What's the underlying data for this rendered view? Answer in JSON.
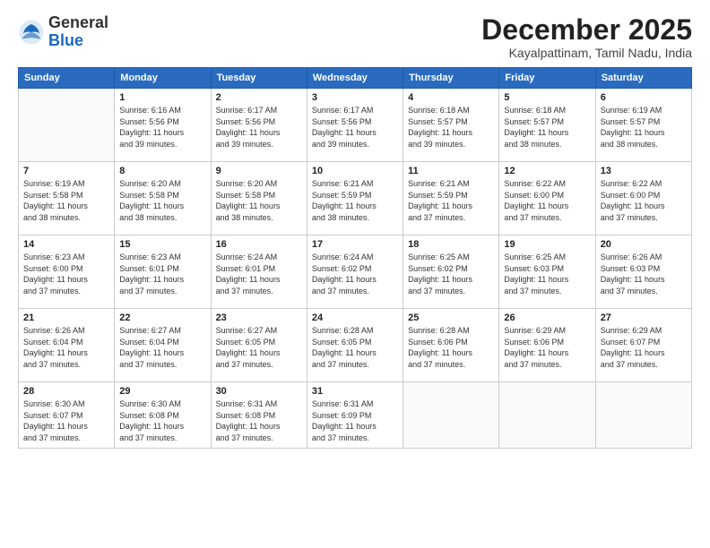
{
  "logo": {
    "general": "General",
    "blue": "Blue"
  },
  "title": {
    "month": "December 2025",
    "location": "Kayalpattinam, Tamil Nadu, India"
  },
  "headers": [
    "Sunday",
    "Monday",
    "Tuesday",
    "Wednesday",
    "Thursday",
    "Friday",
    "Saturday"
  ],
  "weeks": [
    [
      {
        "day": "",
        "info": ""
      },
      {
        "day": "1",
        "info": "Sunrise: 6:16 AM\nSunset: 5:56 PM\nDaylight: 11 hours\nand 39 minutes."
      },
      {
        "day": "2",
        "info": "Sunrise: 6:17 AM\nSunset: 5:56 PM\nDaylight: 11 hours\nand 39 minutes."
      },
      {
        "day": "3",
        "info": "Sunrise: 6:17 AM\nSunset: 5:56 PM\nDaylight: 11 hours\nand 39 minutes."
      },
      {
        "day": "4",
        "info": "Sunrise: 6:18 AM\nSunset: 5:57 PM\nDaylight: 11 hours\nand 39 minutes."
      },
      {
        "day": "5",
        "info": "Sunrise: 6:18 AM\nSunset: 5:57 PM\nDaylight: 11 hours\nand 38 minutes."
      },
      {
        "day": "6",
        "info": "Sunrise: 6:19 AM\nSunset: 5:57 PM\nDaylight: 11 hours\nand 38 minutes."
      }
    ],
    [
      {
        "day": "7",
        "info": "Sunrise: 6:19 AM\nSunset: 5:58 PM\nDaylight: 11 hours\nand 38 minutes."
      },
      {
        "day": "8",
        "info": "Sunrise: 6:20 AM\nSunset: 5:58 PM\nDaylight: 11 hours\nand 38 minutes."
      },
      {
        "day": "9",
        "info": "Sunrise: 6:20 AM\nSunset: 5:58 PM\nDaylight: 11 hours\nand 38 minutes."
      },
      {
        "day": "10",
        "info": "Sunrise: 6:21 AM\nSunset: 5:59 PM\nDaylight: 11 hours\nand 38 minutes."
      },
      {
        "day": "11",
        "info": "Sunrise: 6:21 AM\nSunset: 5:59 PM\nDaylight: 11 hours\nand 37 minutes."
      },
      {
        "day": "12",
        "info": "Sunrise: 6:22 AM\nSunset: 6:00 PM\nDaylight: 11 hours\nand 37 minutes."
      },
      {
        "day": "13",
        "info": "Sunrise: 6:22 AM\nSunset: 6:00 PM\nDaylight: 11 hours\nand 37 minutes."
      }
    ],
    [
      {
        "day": "14",
        "info": "Sunrise: 6:23 AM\nSunset: 6:00 PM\nDaylight: 11 hours\nand 37 minutes."
      },
      {
        "day": "15",
        "info": "Sunrise: 6:23 AM\nSunset: 6:01 PM\nDaylight: 11 hours\nand 37 minutes."
      },
      {
        "day": "16",
        "info": "Sunrise: 6:24 AM\nSunset: 6:01 PM\nDaylight: 11 hours\nand 37 minutes."
      },
      {
        "day": "17",
        "info": "Sunrise: 6:24 AM\nSunset: 6:02 PM\nDaylight: 11 hours\nand 37 minutes."
      },
      {
        "day": "18",
        "info": "Sunrise: 6:25 AM\nSunset: 6:02 PM\nDaylight: 11 hours\nand 37 minutes."
      },
      {
        "day": "19",
        "info": "Sunrise: 6:25 AM\nSunset: 6:03 PM\nDaylight: 11 hours\nand 37 minutes."
      },
      {
        "day": "20",
        "info": "Sunrise: 6:26 AM\nSunset: 6:03 PM\nDaylight: 11 hours\nand 37 minutes."
      }
    ],
    [
      {
        "day": "21",
        "info": "Sunrise: 6:26 AM\nSunset: 6:04 PM\nDaylight: 11 hours\nand 37 minutes."
      },
      {
        "day": "22",
        "info": "Sunrise: 6:27 AM\nSunset: 6:04 PM\nDaylight: 11 hours\nand 37 minutes."
      },
      {
        "day": "23",
        "info": "Sunrise: 6:27 AM\nSunset: 6:05 PM\nDaylight: 11 hours\nand 37 minutes."
      },
      {
        "day": "24",
        "info": "Sunrise: 6:28 AM\nSunset: 6:05 PM\nDaylight: 11 hours\nand 37 minutes."
      },
      {
        "day": "25",
        "info": "Sunrise: 6:28 AM\nSunset: 6:06 PM\nDaylight: 11 hours\nand 37 minutes."
      },
      {
        "day": "26",
        "info": "Sunrise: 6:29 AM\nSunset: 6:06 PM\nDaylight: 11 hours\nand 37 minutes."
      },
      {
        "day": "27",
        "info": "Sunrise: 6:29 AM\nSunset: 6:07 PM\nDaylight: 11 hours\nand 37 minutes."
      }
    ],
    [
      {
        "day": "28",
        "info": "Sunrise: 6:30 AM\nSunset: 6:07 PM\nDaylight: 11 hours\nand 37 minutes."
      },
      {
        "day": "29",
        "info": "Sunrise: 6:30 AM\nSunset: 6:08 PM\nDaylight: 11 hours\nand 37 minutes."
      },
      {
        "day": "30",
        "info": "Sunrise: 6:31 AM\nSunset: 6:08 PM\nDaylight: 11 hours\nand 37 minutes."
      },
      {
        "day": "31",
        "info": "Sunrise: 6:31 AM\nSunset: 6:09 PM\nDaylight: 11 hours\nand 37 minutes."
      },
      {
        "day": "",
        "info": ""
      },
      {
        "day": "",
        "info": ""
      },
      {
        "day": "",
        "info": ""
      }
    ]
  ]
}
